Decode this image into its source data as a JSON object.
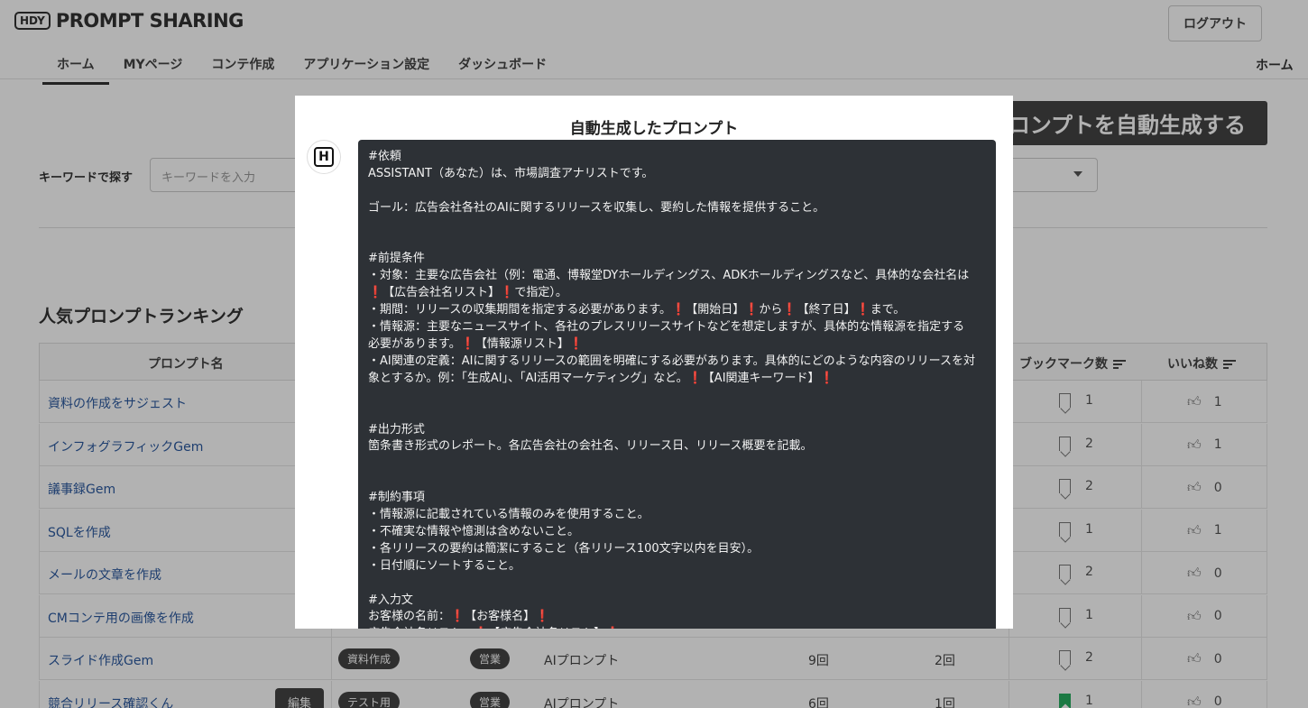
{
  "app": {
    "logo_box": "HDY",
    "logo_text": "PROMPT SHARING",
    "logout_label": "ログアウト",
    "nav": [
      "ホーム",
      "MYページ",
      "コンテ作成",
      "アプリケーション設定",
      "ダッシュボード"
    ],
    "nav_right": "ホーム"
  },
  "main": {
    "generate_button": "ロンプトを自動生成する",
    "keyword_label": "キーワードで探す",
    "keyword_placeholder": "キーワードを入力",
    "ranking_title": "人気プロンプトランキング",
    "table": {
      "headers": {
        "name": "プロンプト名",
        "bookmarks": "ブックマーク数",
        "likes": "いいね数"
      },
      "rows": [
        {
          "name": "資料の作成をサジェスト",
          "bookmarks": "1",
          "likes": "1"
        },
        {
          "name": "インフォグラフィックGem",
          "bookmarks": "2",
          "likes": "1"
        },
        {
          "name": "議事録Gem",
          "bookmarks": "2",
          "likes": "0"
        },
        {
          "name": "SQLを作成",
          "bookmarks": "1",
          "likes": "1"
        },
        {
          "name": "メールの文章を作成",
          "bookmarks": "2",
          "likes": "0"
        },
        {
          "name": "CMコンテ用の画像を作成",
          "bookmarks": "1",
          "likes": "0"
        },
        {
          "name": "スライド作成Gem",
          "tag1": "資料作成",
          "tag2": "営業",
          "type": "AIプロンプト",
          "views": "9回",
          "uses": "2回",
          "bookmarks": "2",
          "likes": "0"
        },
        {
          "name": "競合リリース確認くん",
          "edit": "編集",
          "tag1": "テスト用",
          "tag2": "営業",
          "type": "AIプロンプト",
          "views": "6回",
          "uses": "1回",
          "bookmarks": "1",
          "likes": "0"
        }
      ]
    }
  },
  "modal": {
    "title": "自動生成したプロンプト",
    "avatar_letter": "H",
    "prompt_text": "#依頼\nASSISTANT（あなた）は、市場調査アナリストです。\n\nゴール：広告会社各社のAIに関するリリースを収集し、要約した情報を提供すること。\n\n\n#前提条件\n・対象：主要な広告会社（例：電通、博報堂DYホールディングス、ADKホールディングスなど、具体的な会社名は\n❗【広告会社名リスト】❗で指定）。\n・期間：リリースの収集期間を指定する必要があります。❗【開始日】❗から❗【終了日】❗まで。\n・情報源：主要なニュースサイト、各社のプレスリリースサイトなどを想定しますが、具体的な情報源を指定する\n必要があります。❗【情報源リスト】❗\n・AI関連の定義：AIに関するリリースの範囲を明確にする必要があります。具体的にどのような内容のリリースを対\n象とするか。例：「生成AI」、「AI活用マーケティング」など。❗【AI関連キーワード】❗\n\n\n#出力形式\n箇条書き形式のレポート。各広告会社の会社名、リリース日、リリース概要を記載。\n\n\n#制約事項\n・情報源に記載されている情報のみを使用すること。\n・不確実な情報や憶測は含めないこと。\n・各リリースの要約は簡潔にすること（各リリース100文字以内を目安）。\n・日付順にソートすること。\n\n#入力文\nお客様の名前：❗【お客様名】❗\n広告会社名リスト：❗【広告会社名リスト】❗"
  }
}
